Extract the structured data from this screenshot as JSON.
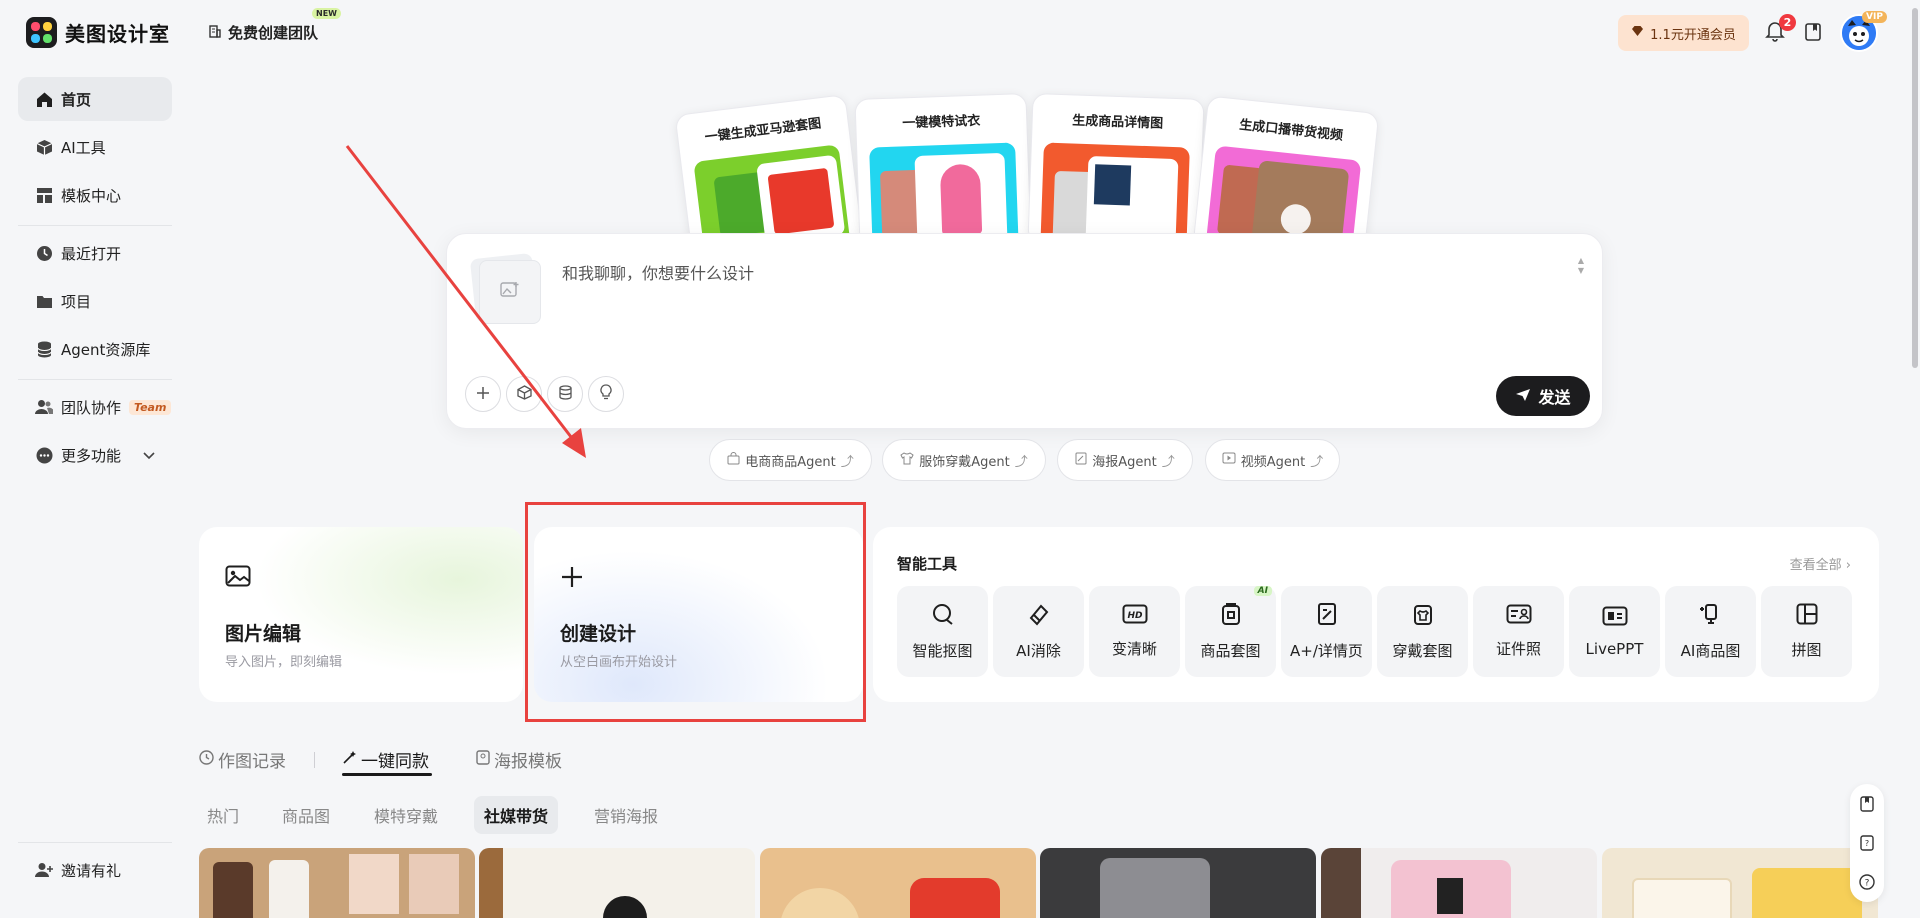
{
  "brand": {
    "name": "美图设计室",
    "team_link": "免费创建团队",
    "new_badge": "NEW"
  },
  "header": {
    "vip_label": "1.1元开通会员",
    "notification_count": "2",
    "vip_tag": "VIP"
  },
  "sidebar": {
    "items": [
      {
        "label": "首页",
        "icon": "home-icon"
      },
      {
        "label": "AI工具",
        "icon": "cube-icon"
      },
      {
        "label": "模板中心",
        "icon": "grid-icon"
      },
      {
        "label": "最近打开",
        "icon": "clock-icon"
      },
      {
        "label": "项目",
        "icon": "folder-icon"
      },
      {
        "label": "Agent资源库",
        "icon": "database-icon"
      },
      {
        "label": "团队协作",
        "icon": "people-icon",
        "tag": "Team"
      },
      {
        "label": "更多功能",
        "icon": "more-icon"
      }
    ],
    "invite": "邀请有礼"
  },
  "hero_cards": [
    {
      "title": "一键生成亚马逊套图"
    },
    {
      "title": "一键模特试衣"
    },
    {
      "title": "生成商品详情图"
    },
    {
      "title": "生成口播带货视频"
    }
  ],
  "chat": {
    "placeholder": "和我聊聊，你想要什么设计",
    "send_label": "发送"
  },
  "agents": [
    {
      "label": "电商商品Agent"
    },
    {
      "label": "服饰穿戴Agent"
    },
    {
      "label": "海报Agent"
    },
    {
      "label": "视频Agent"
    }
  ],
  "features": {
    "edit": {
      "title": "图片编辑",
      "subtitle": "导入图片，即刻编辑"
    },
    "create": {
      "title": "创建设计",
      "subtitle": "从空白画布开始设计"
    }
  },
  "tools": {
    "title": "智能工具",
    "see_all": "查看全部",
    "items": [
      {
        "label": "智能抠图",
        "icon": "cutout-icon"
      },
      {
        "label": "AI消除",
        "icon": "eraser-icon"
      },
      {
        "label": "变清晰",
        "icon": "hd-icon"
      },
      {
        "label": "商品套图",
        "icon": "product-set-icon",
        "badge": "AI"
      },
      {
        "label": "A+/详情页",
        "icon": "detail-page-icon"
      },
      {
        "label": "穿戴套图",
        "icon": "wear-set-icon"
      },
      {
        "label": "证件照",
        "icon": "id-photo-icon"
      },
      {
        "label": "LivePPT",
        "icon": "ppt-icon"
      },
      {
        "label": "AI商品图",
        "icon": "ai-product-icon"
      },
      {
        "label": "拼图",
        "icon": "collage-icon"
      }
    ]
  },
  "tabs": [
    {
      "label": "作图记录"
    },
    {
      "label": "一键同款"
    },
    {
      "label": "海报模板"
    }
  ],
  "sub_tabs": [
    {
      "label": "热门"
    },
    {
      "label": "商品图"
    },
    {
      "label": "模特穿戴"
    },
    {
      "label": "社媒带货"
    },
    {
      "label": "营销海报"
    }
  ],
  "colors": {
    "accent_dark": "#1c1c1e",
    "highlight_red": "#e8423f",
    "vip_bg": "#fde3d0"
  }
}
